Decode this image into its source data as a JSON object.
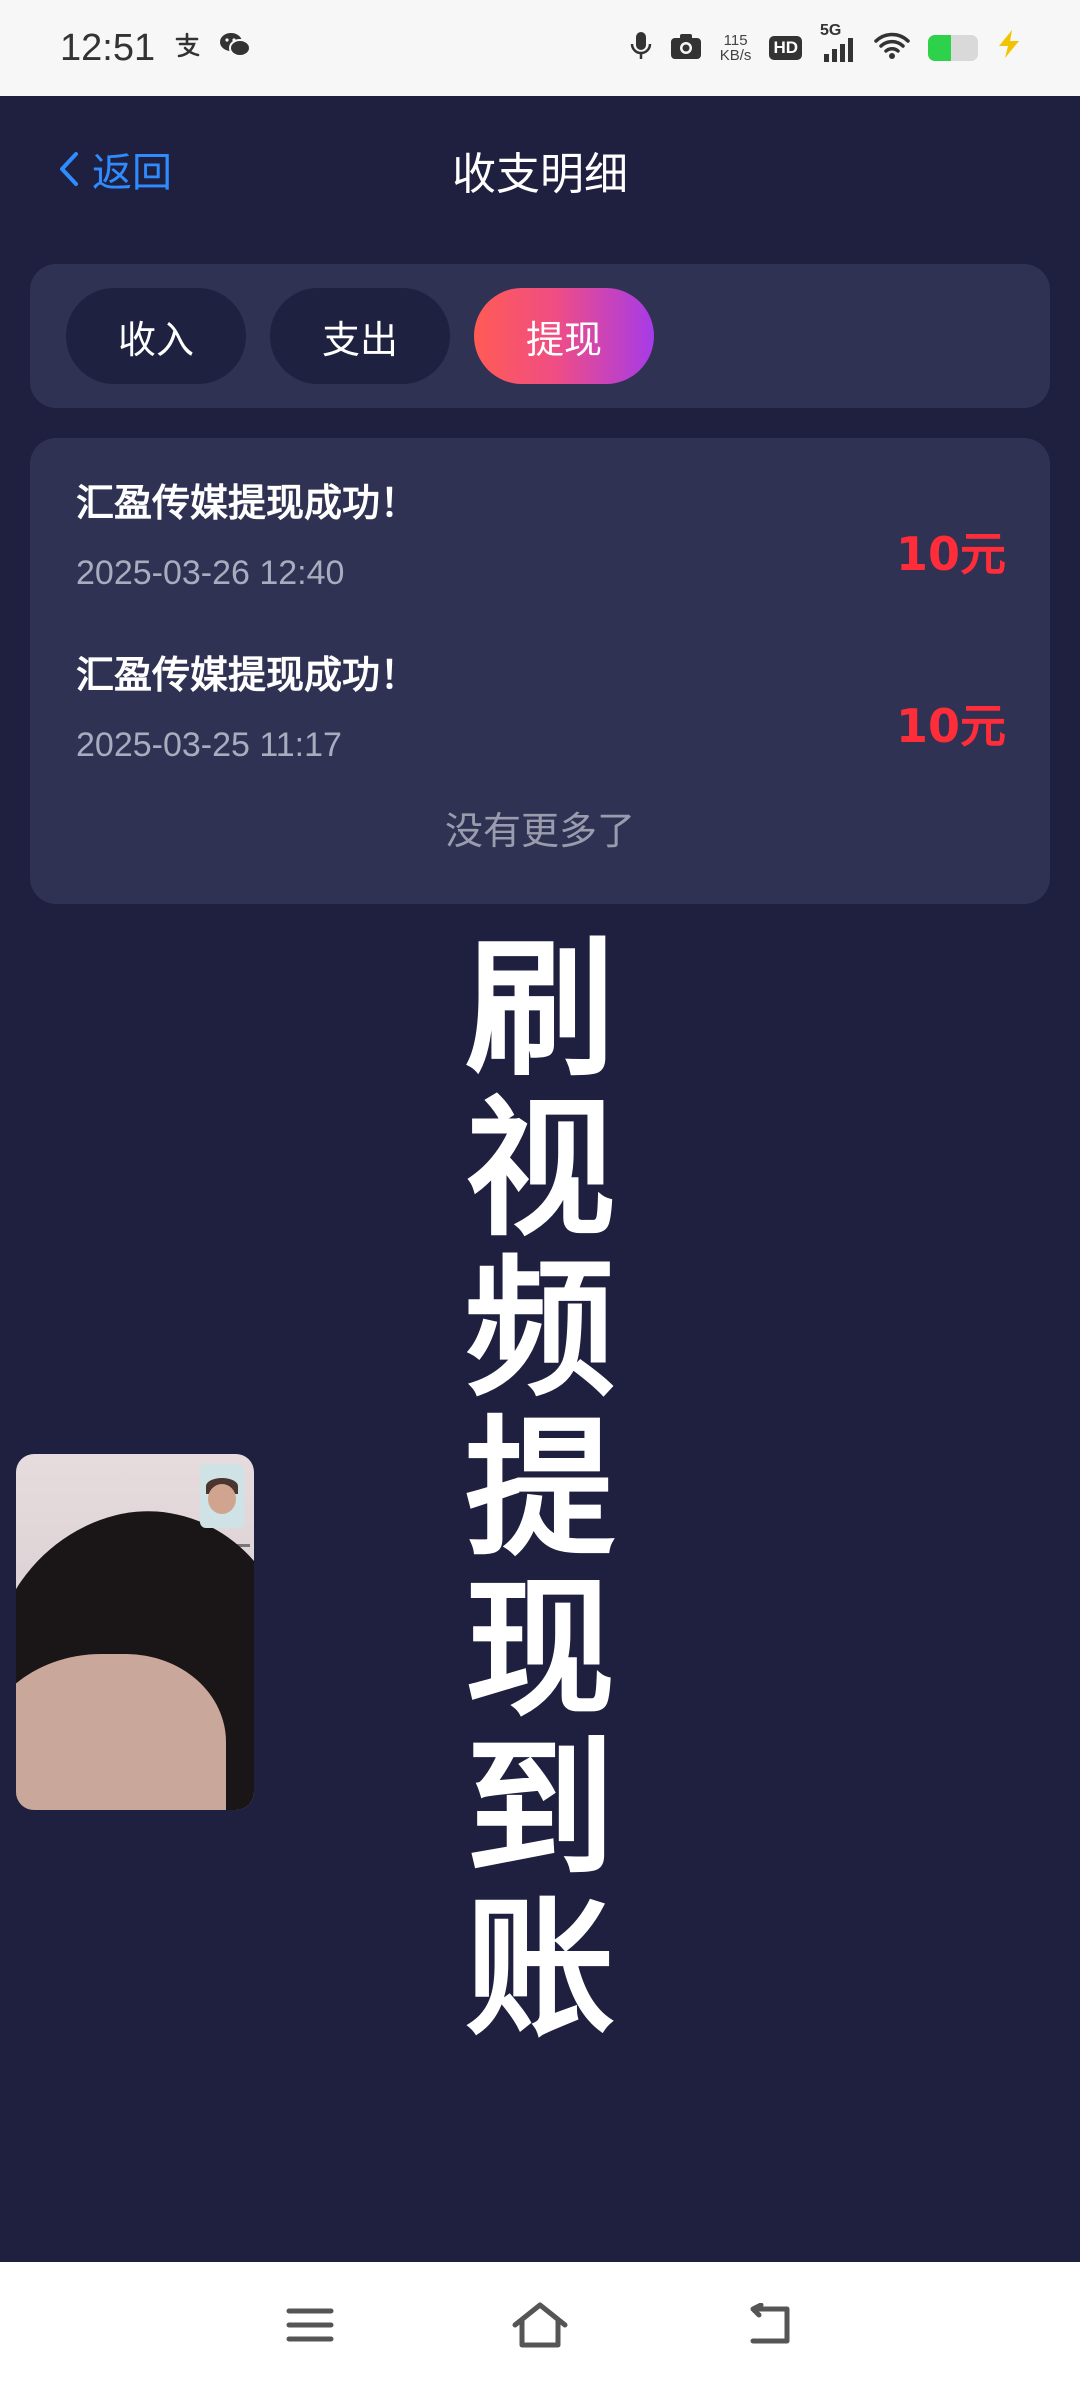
{
  "status_bar": {
    "time": "12:51",
    "left_icons": [
      "alipay-icon",
      "wechat-icon"
    ],
    "right_icons": [
      "mic-icon",
      "camera-icon",
      "hd-icon",
      "5g-signal-icon",
      "wifi-icon",
      "battery-icon",
      "charging-icon"
    ],
    "net_speed_value": "115",
    "net_speed_unit": "KB/s",
    "hd_label": "HD",
    "network_label": "5G",
    "battery_level": 0.45,
    "colors": {
      "battery_fill": "#2dd24a",
      "charging": "#f2c300"
    }
  },
  "header": {
    "back_label": "返回",
    "title": "收支明细"
  },
  "tabs": {
    "items": [
      {
        "label": "收入",
        "active": false
      },
      {
        "label": "支出",
        "active": false
      },
      {
        "label": "提现",
        "active": true
      }
    ]
  },
  "records": {
    "items": [
      {
        "title": "汇盈传媒提现成功！",
        "time": "2025-03-26 12:40",
        "amount": "10元"
      },
      {
        "title": "汇盈传媒提现成功！",
        "time": "2025-03-25 11:17",
        "amount": "10元"
      }
    ],
    "end_text": "没有更多了"
  },
  "overlay": {
    "chars": [
      "刷",
      "视",
      "频",
      "提",
      "现",
      "到",
      "账"
    ]
  },
  "video_call": {
    "description_icon": "video-call-window"
  },
  "nav_bar": {
    "icons": [
      "menu-icon",
      "home-icon",
      "back-icon"
    ]
  },
  "colors": {
    "background": "#1f1f3f",
    "card": "#2f3252",
    "accent_blue": "#2f8cff",
    "amount_red": "#ff2d3a",
    "tab_gradient": [
      "#ff5b55",
      "#f04d84",
      "#a63be8"
    ]
  }
}
